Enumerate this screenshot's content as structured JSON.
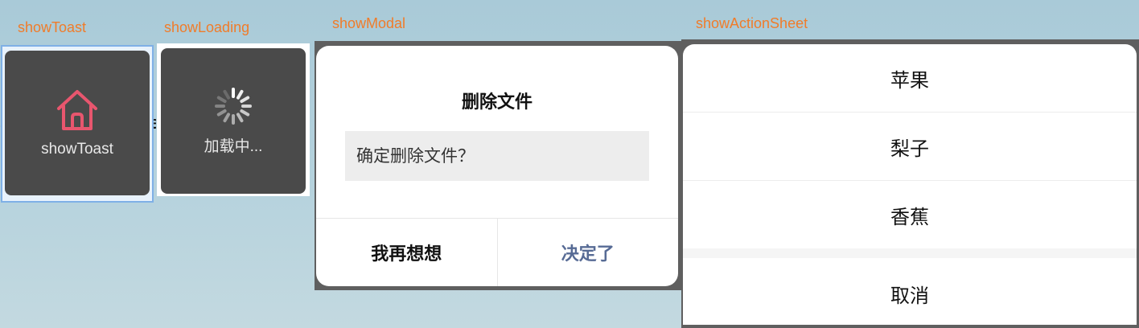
{
  "captions": {
    "toast": "showToast",
    "loading": "showLoading",
    "modal": "showModal",
    "action_sheet": "showActionSheet"
  },
  "toast": {
    "icon": "home-icon",
    "label": "showToast"
  },
  "loading": {
    "icon": "spinner-icon",
    "label": "加载中..."
  },
  "modal": {
    "title": "删除文件",
    "content": "确定删除文件？",
    "cancel_label": "我再想想",
    "confirm_label": "决定了",
    "confirm_color": "#576b95"
  },
  "action_sheet": {
    "items": [
      "苹果",
      "梨子",
      "香蕉"
    ],
    "cancel_label": "取消"
  },
  "colors": {
    "caption": "#f07c2a",
    "toast_icon": "#e8566e"
  }
}
